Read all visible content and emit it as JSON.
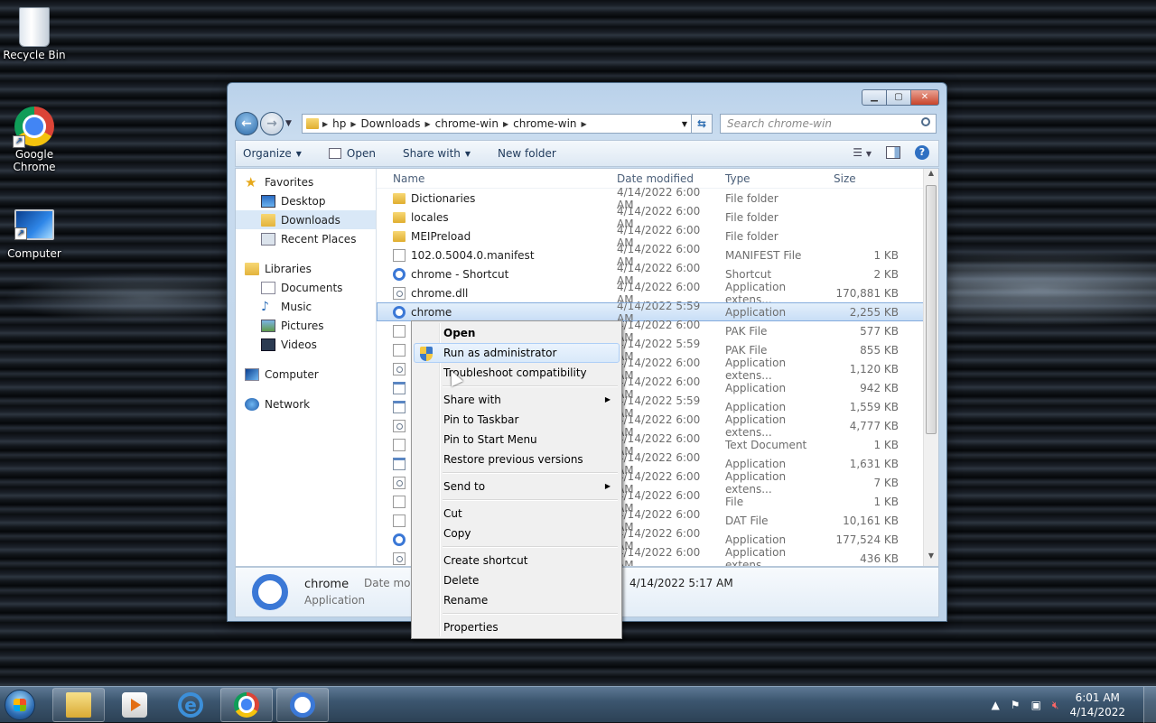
{
  "desktop": {
    "icons": [
      {
        "label": "Recycle Bin",
        "icon": "recycle-bin-icon"
      },
      {
        "label": "Google Chrome",
        "icon": "chrome-icon"
      },
      {
        "label": "Computer",
        "icon": "computer-icon"
      }
    ]
  },
  "window": {
    "caption_buttons": {
      "minimize": "minimize-icon",
      "maximize": "maximize-icon",
      "close": "close-icon"
    },
    "address": {
      "segments": [
        "hp",
        "Downloads",
        "chrome-win",
        "chrome-win"
      ]
    },
    "search": {
      "placeholder": "Search chrome-win"
    },
    "toolbar": {
      "organize": "Organize",
      "open": "Open",
      "share_with": "Share with",
      "new_folder": "New folder"
    },
    "nav": {
      "favorites": "Favorites",
      "desktop": "Desktop",
      "downloads": "Downloads",
      "recent_places": "Recent Places",
      "libraries": "Libraries",
      "documents": "Documents",
      "music": "Music",
      "pictures": "Pictures",
      "videos": "Videos",
      "computer": "Computer",
      "network": "Network"
    },
    "columns": {
      "name": "Name",
      "date": "Date modified",
      "type": "Type",
      "size": "Size"
    },
    "files": [
      {
        "name": "Dictionaries",
        "date": "4/14/2022 6:00 AM",
        "type": "File folder",
        "size": "",
        "icon": "folder"
      },
      {
        "name": "locales",
        "date": "4/14/2022 6:00 AM",
        "type": "File folder",
        "size": "",
        "icon": "folder"
      },
      {
        "name": "MEIPreload",
        "date": "4/14/2022 6:00 AM",
        "type": "File folder",
        "size": "",
        "icon": "folder"
      },
      {
        "name": "102.0.5004.0.manifest",
        "date": "4/14/2022 6:00 AM",
        "type": "MANIFEST File",
        "size": "1 KB",
        "icon": "doc"
      },
      {
        "name": "chrome - Shortcut",
        "date": "4/14/2022 6:00 AM",
        "type": "Shortcut",
        "size": "2 KB",
        "icon": "chrome"
      },
      {
        "name": "chrome.dll",
        "date": "4/14/2022 6:00 AM",
        "type": "Application extens...",
        "size": "170,881 KB",
        "icon": "dll"
      },
      {
        "name": "chrome",
        "date": "4/14/2022 5:59 AM",
        "type": "Application",
        "size": "2,255 KB",
        "icon": "chrome"
      },
      {
        "name": "",
        "date": "4/14/2022 6:00 AM",
        "type": "PAK File",
        "size": "577 KB",
        "icon": "doc"
      },
      {
        "name": "",
        "date": "4/14/2022 5:59 AM",
        "type": "PAK File",
        "size": "855 KB",
        "icon": "doc"
      },
      {
        "name": "",
        "date": "4/14/2022 6:00 AM",
        "type": "Application extens...",
        "size": "1,120 KB",
        "icon": "dll"
      },
      {
        "name": "",
        "date": "4/14/2022 6:00 AM",
        "type": "Application",
        "size": "942 KB",
        "icon": "exe"
      },
      {
        "name": "",
        "date": "4/14/2022 5:59 AM",
        "type": "Application",
        "size": "1,559 KB",
        "icon": "exe"
      },
      {
        "name": "",
        "date": "4/14/2022 6:00 AM",
        "type": "Application extens...",
        "size": "4,777 KB",
        "icon": "dll"
      },
      {
        "name": "",
        "date": "4/14/2022 6:00 AM",
        "type": "Text Document",
        "size": "1 KB",
        "icon": "doc"
      },
      {
        "name": "",
        "date": "4/14/2022 6:00 AM",
        "type": "Application",
        "size": "1,631 KB",
        "icon": "exe"
      },
      {
        "name": "",
        "date": "4/14/2022 6:00 AM",
        "type": "Application extens...",
        "size": "7 KB",
        "icon": "dll"
      },
      {
        "name": "",
        "date": "4/14/2022 6:00 AM",
        "type": "File",
        "size": "1 KB",
        "icon": "doc"
      },
      {
        "name": "",
        "date": "4/14/2022 6:00 AM",
        "type": "DAT File",
        "size": "10,161 KB",
        "icon": "doc"
      },
      {
        "name": "",
        "date": "4/14/2022 6:00 AM",
        "type": "Application",
        "size": "177,524 KB",
        "icon": "chrome"
      },
      {
        "name": "",
        "date": "4/14/2022 6:00 AM",
        "type": "Application extens...",
        "size": "436 KB",
        "icon": "dll"
      }
    ],
    "details": {
      "name": "chrome",
      "type": "Application",
      "date_label": "Date mod",
      "date_value": "4/14/2022 5:17 AM"
    }
  },
  "context_menu": {
    "open": "Open",
    "run_as_admin": "Run as administrator",
    "troubleshoot": "Troubleshoot compatibility",
    "share_with": "Share with",
    "pin_taskbar": "Pin to Taskbar",
    "pin_start": "Pin to Start Menu",
    "restore": "Restore previous versions",
    "send_to": "Send to",
    "cut": "Cut",
    "copy": "Copy",
    "create_shortcut": "Create shortcut",
    "delete": "Delete",
    "rename": "Rename",
    "properties": "Properties"
  },
  "taskbar": {
    "apps": [
      "windows-explorer-icon",
      "media-player-icon",
      "internet-explorer-icon",
      "chrome-icon",
      "chrome-icon"
    ],
    "ie_glyph": "e",
    "clock": {
      "time": "6:01 AM",
      "date": "4/14/2022"
    }
  }
}
